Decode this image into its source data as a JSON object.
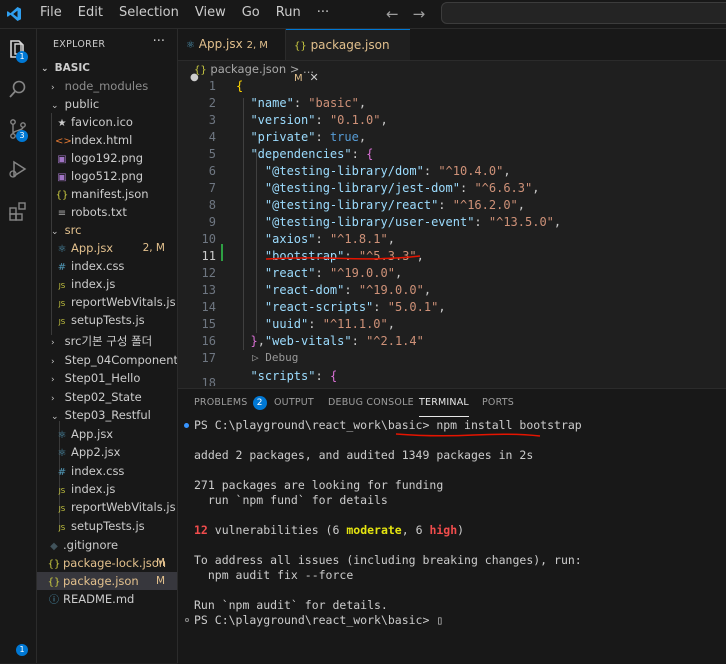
{
  "menu": [
    "File",
    "Edit",
    "Selection",
    "View",
    "Go",
    "Run",
    "···"
  ],
  "nav": {
    "back": "←",
    "forward": "→"
  },
  "activity_badges": {
    "explorer": "1",
    "source_control": "3",
    "accounts": "1"
  },
  "sidebar": {
    "title": "EXPLORER",
    "more": "···",
    "root": "BASIC",
    "items": [
      {
        "label": "node_modules",
        "icon": "",
        "status": ""
      },
      {
        "label": "public",
        "icon": "",
        "status": ""
      },
      {
        "label": "favicon.ico",
        "icon": "★",
        "status": ""
      },
      {
        "label": "index.html",
        "icon": "<>",
        "status": ""
      },
      {
        "label": "logo192.png",
        "icon": "▣",
        "status": ""
      },
      {
        "label": "logo512.png",
        "icon": "▣",
        "status": ""
      },
      {
        "label": "manifest.json",
        "icon": "{}",
        "status": ""
      },
      {
        "label": "robots.txt",
        "icon": "≡",
        "status": ""
      },
      {
        "label": "src",
        "icon": "",
        "status": ""
      },
      {
        "label": "App.jsx",
        "icon": "⚛",
        "status": "2, M"
      },
      {
        "label": "index.css",
        "icon": "#",
        "status": ""
      },
      {
        "label": "index.js",
        "icon": "JS",
        "status": ""
      },
      {
        "label": "reportWebVitals.js",
        "icon": "JS",
        "status": ""
      },
      {
        "label": "setupTests.js",
        "icon": "JS",
        "status": ""
      },
      {
        "label": "src기본 구성 폴더",
        "icon": "",
        "status": ""
      },
      {
        "label": "Step_04Component",
        "icon": "",
        "status": ""
      },
      {
        "label": "Step01_Hello",
        "icon": "",
        "status": ""
      },
      {
        "label": "Step02_State",
        "icon": "",
        "status": ""
      },
      {
        "label": "Step03_Restful",
        "icon": "",
        "status": ""
      },
      {
        "label": "App.jsx",
        "icon": "⚛",
        "status": ""
      },
      {
        "label": "App2.jsx",
        "icon": "⚛",
        "status": ""
      },
      {
        "label": "index.css",
        "icon": "#",
        "status": ""
      },
      {
        "label": "index.js",
        "icon": "JS",
        "status": ""
      },
      {
        "label": "reportWebVitals.js",
        "icon": "JS",
        "status": ""
      },
      {
        "label": "setupTests.js",
        "icon": "JS",
        "status": ""
      },
      {
        "label": ".gitignore",
        "icon": "◆",
        "status": ""
      },
      {
        "label": "package-lock.json",
        "icon": "{}",
        "status": "M"
      },
      {
        "label": "package.json",
        "icon": "{}",
        "status": "M"
      },
      {
        "label": "README.md",
        "icon": "ⓘ",
        "status": ""
      }
    ]
  },
  "tabs": [
    {
      "label": "App.jsx",
      "status": "2, M",
      "icon": "⚛",
      "mark": "●"
    },
    {
      "label": "package.json",
      "status": "M",
      "icon": "{}",
      "mark": "✕"
    }
  ],
  "breadcrumb": {
    "file": "package.json",
    "rest": "> ..."
  },
  "code": {
    "line_numbers": [
      "1",
      "2",
      "3",
      "4",
      "5",
      "6",
      "7",
      "8",
      "9",
      "10",
      "11",
      "12",
      "13",
      "14",
      "15",
      "16",
      "17",
      "18"
    ],
    "name_key": "\"name\"",
    "name_val": "\"basic\"",
    "version_key": "\"version\"",
    "version_val": "\"0.1.0\"",
    "private_key": "\"private\"",
    "private_val": "true",
    "deps_key": "\"dependencies\"",
    "deps": [
      {
        "k": "\"@testing-library/dom\"",
        "v": "\"^10.4.0\""
      },
      {
        "k": "\"@testing-library/jest-dom\"",
        "v": "\"^6.6.3\""
      },
      {
        "k": "\"@testing-library/react\"",
        "v": "\"^16.2.0\""
      },
      {
        "k": "\"@testing-library/user-event\"",
        "v": "\"^13.5.0\""
      },
      {
        "k": "\"axios\"",
        "v": "\"^1.8.1\""
      },
      {
        "k": "\"bootstrap\"",
        "v": "\"^5.3.3\""
      },
      {
        "k": "\"react\"",
        "v": "\"^19.0.0\""
      },
      {
        "k": "\"react-dom\"",
        "v": "\"^19.0.0\""
      },
      {
        "k": "\"react-scripts\"",
        "v": "\"5.0.1\""
      },
      {
        "k": "\"uuid\"",
        "v": "\"^11.1.0\""
      },
      {
        "k": "\"web-vitals\"",
        "v": "\"^2.1.4\""
      }
    ],
    "debug": "▷ Debug",
    "scripts_key": "\"scripts\""
  },
  "panel": {
    "tabs": [
      "PROBLEMS",
      "OUTPUT",
      "DEBUG CONSOLE",
      "TERMINAL",
      "PORTS"
    ],
    "problems_count": "2",
    "prompt": "PS C:\\playground\\react_work\\basic> ",
    "command": "npm install bootstrap",
    "out1": "added 2 packages, and audited 1349 packages in 2s",
    "out2": "271 packages are looking for funding",
    "out3": "  run `npm fund` for details",
    "vuln_count": "12",
    "vuln_text": " vulnerabilities (6 ",
    "moderate": "moderate",
    "sep": ", 6 ",
    "high": "high",
    "close": ")",
    "out5": "To address all issues (including breaking changes), run:",
    "out6": "  npm audit fix --force",
    "out7": "Run `npm audit` for details.",
    "prompt2": "PS C:\\playground\\react_work\\basic> ",
    "cursor": "▯"
  },
  "colors": {
    "accent": "#0078d4",
    "modified": "#e2c08d",
    "annotation": "#e51400"
  }
}
